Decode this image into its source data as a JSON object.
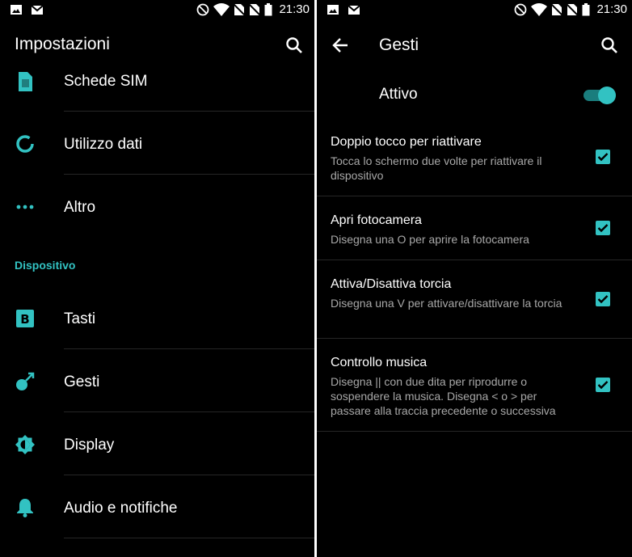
{
  "status_bar": {
    "time": "21:30"
  },
  "left_screen": {
    "title": "Impostazioni",
    "items_top": [
      {
        "label": "Schede SIM",
        "icon": "sim-card-icon"
      },
      {
        "label": "Utilizzo dati",
        "icon": "data-usage-icon"
      },
      {
        "label": "Altro",
        "icon": "more-dots-icon"
      }
    ],
    "section_header": "Dispositivo",
    "items_device": [
      {
        "label": "Tasti",
        "icon": "buttons-icon"
      },
      {
        "label": "Gesti",
        "icon": "gestures-icon"
      },
      {
        "label": "Display",
        "icon": "brightness-icon"
      },
      {
        "label": "Audio e notifiche",
        "icon": "bell-icon"
      }
    ]
  },
  "right_screen": {
    "title": "Gesti",
    "master_switch": {
      "label": "Attivo",
      "on": true
    },
    "gestures": [
      {
        "title": "Doppio tocco per riattivare",
        "desc": "Tocca lo schermo due volte per riattivare il dispositivo",
        "checked": true
      },
      {
        "title": "Apri fotocamera",
        "desc": "Disegna una O per aprire la fotocamera",
        "checked": true
      },
      {
        "title": "Attiva/Disattiva torcia",
        "desc": "Disegna una V per attivare/disattivare la torcia",
        "checked": true
      },
      {
        "title": "Controllo musica",
        "desc": "Disegna || con due dita per riprodurre o sospendere la musica. Disegna < o > per passare alla traccia precedente o successiva",
        "checked": true
      }
    ]
  },
  "colors": {
    "accent": "#32c2c2",
    "background": "#000000",
    "divider": "#262626",
    "secondary_text": "#a8a8a8"
  }
}
